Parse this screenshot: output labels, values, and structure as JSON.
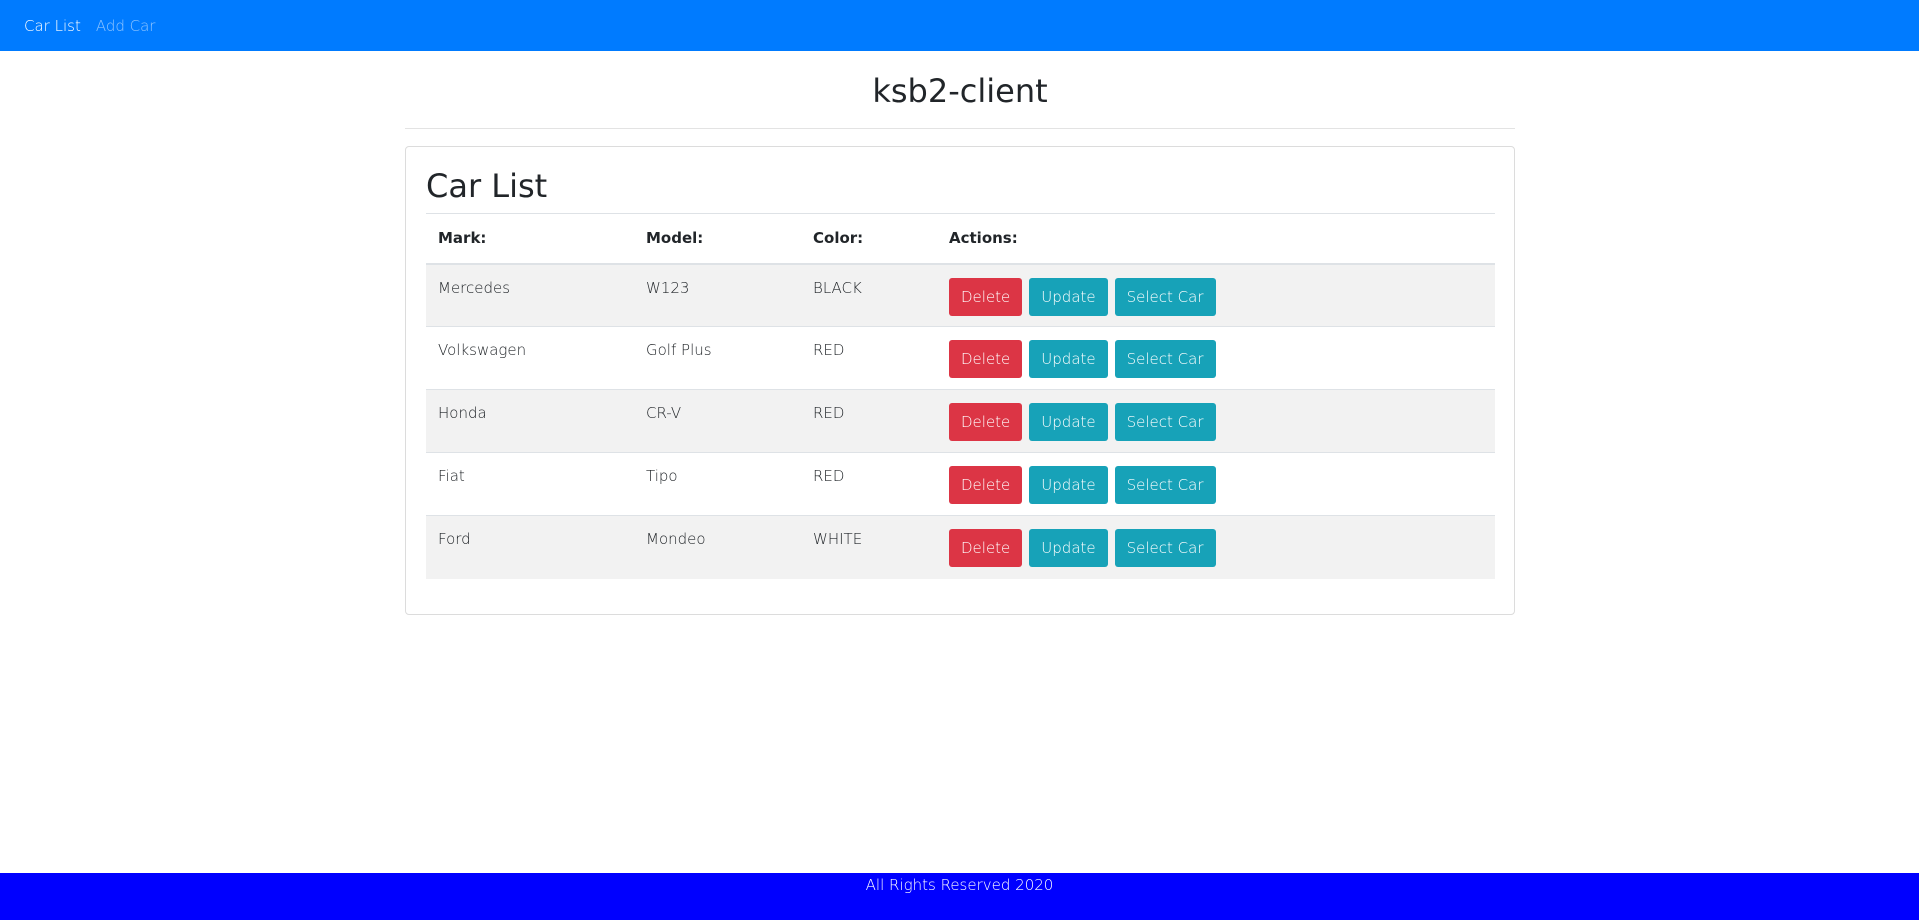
{
  "nav": {
    "items": [
      {
        "label": "Car List",
        "active": true
      },
      {
        "label": "Add Car",
        "active": false
      }
    ],
    "color": "#007bff"
  },
  "app_title": "ksb2-client",
  "card": {
    "heading": "Car List",
    "columns": [
      "Mark:",
      "Model:",
      "Color:",
      "Actions:"
    ],
    "rows": [
      {
        "mark": "Mercedes",
        "model": "W123",
        "color": "BLACK"
      },
      {
        "mark": "Volkswagen",
        "model": "Golf Plus",
        "color": "RED"
      },
      {
        "mark": "Honda",
        "model": "CR-V",
        "color": "RED"
      },
      {
        "mark": "Fiat",
        "model": "Tipo",
        "color": "RED"
      },
      {
        "mark": "Ford",
        "model": "Mondeo",
        "color": "WHITE"
      }
    ],
    "actions": {
      "delete_label": "Delete",
      "update_label": "Update",
      "select_label": "Select Car"
    }
  },
  "footer": {
    "text": "All Rights Reserved 2020",
    "color": "#0000ff"
  },
  "colors": {
    "danger": "#dc3545",
    "info": "#17a2b8"
  }
}
